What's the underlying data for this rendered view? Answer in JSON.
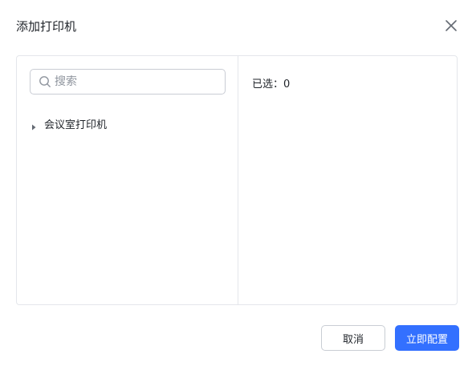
{
  "dialog": {
    "title": "添加打印机",
    "close_icon": "close-icon"
  },
  "search": {
    "placeholder": "搜索",
    "value": "",
    "icon": "search-icon"
  },
  "tree": {
    "items": [
      {
        "label": "会议室打印机",
        "icon": "caret-right-icon"
      }
    ]
  },
  "selection": {
    "text": "已选：0"
  },
  "footer": {
    "cancel_label": "取消",
    "confirm_label": "立即配置"
  },
  "colors": {
    "accent": "#3370ff",
    "border": "#e4e6eb",
    "text": "#1f2329",
    "placeholder": "#8f959e"
  }
}
